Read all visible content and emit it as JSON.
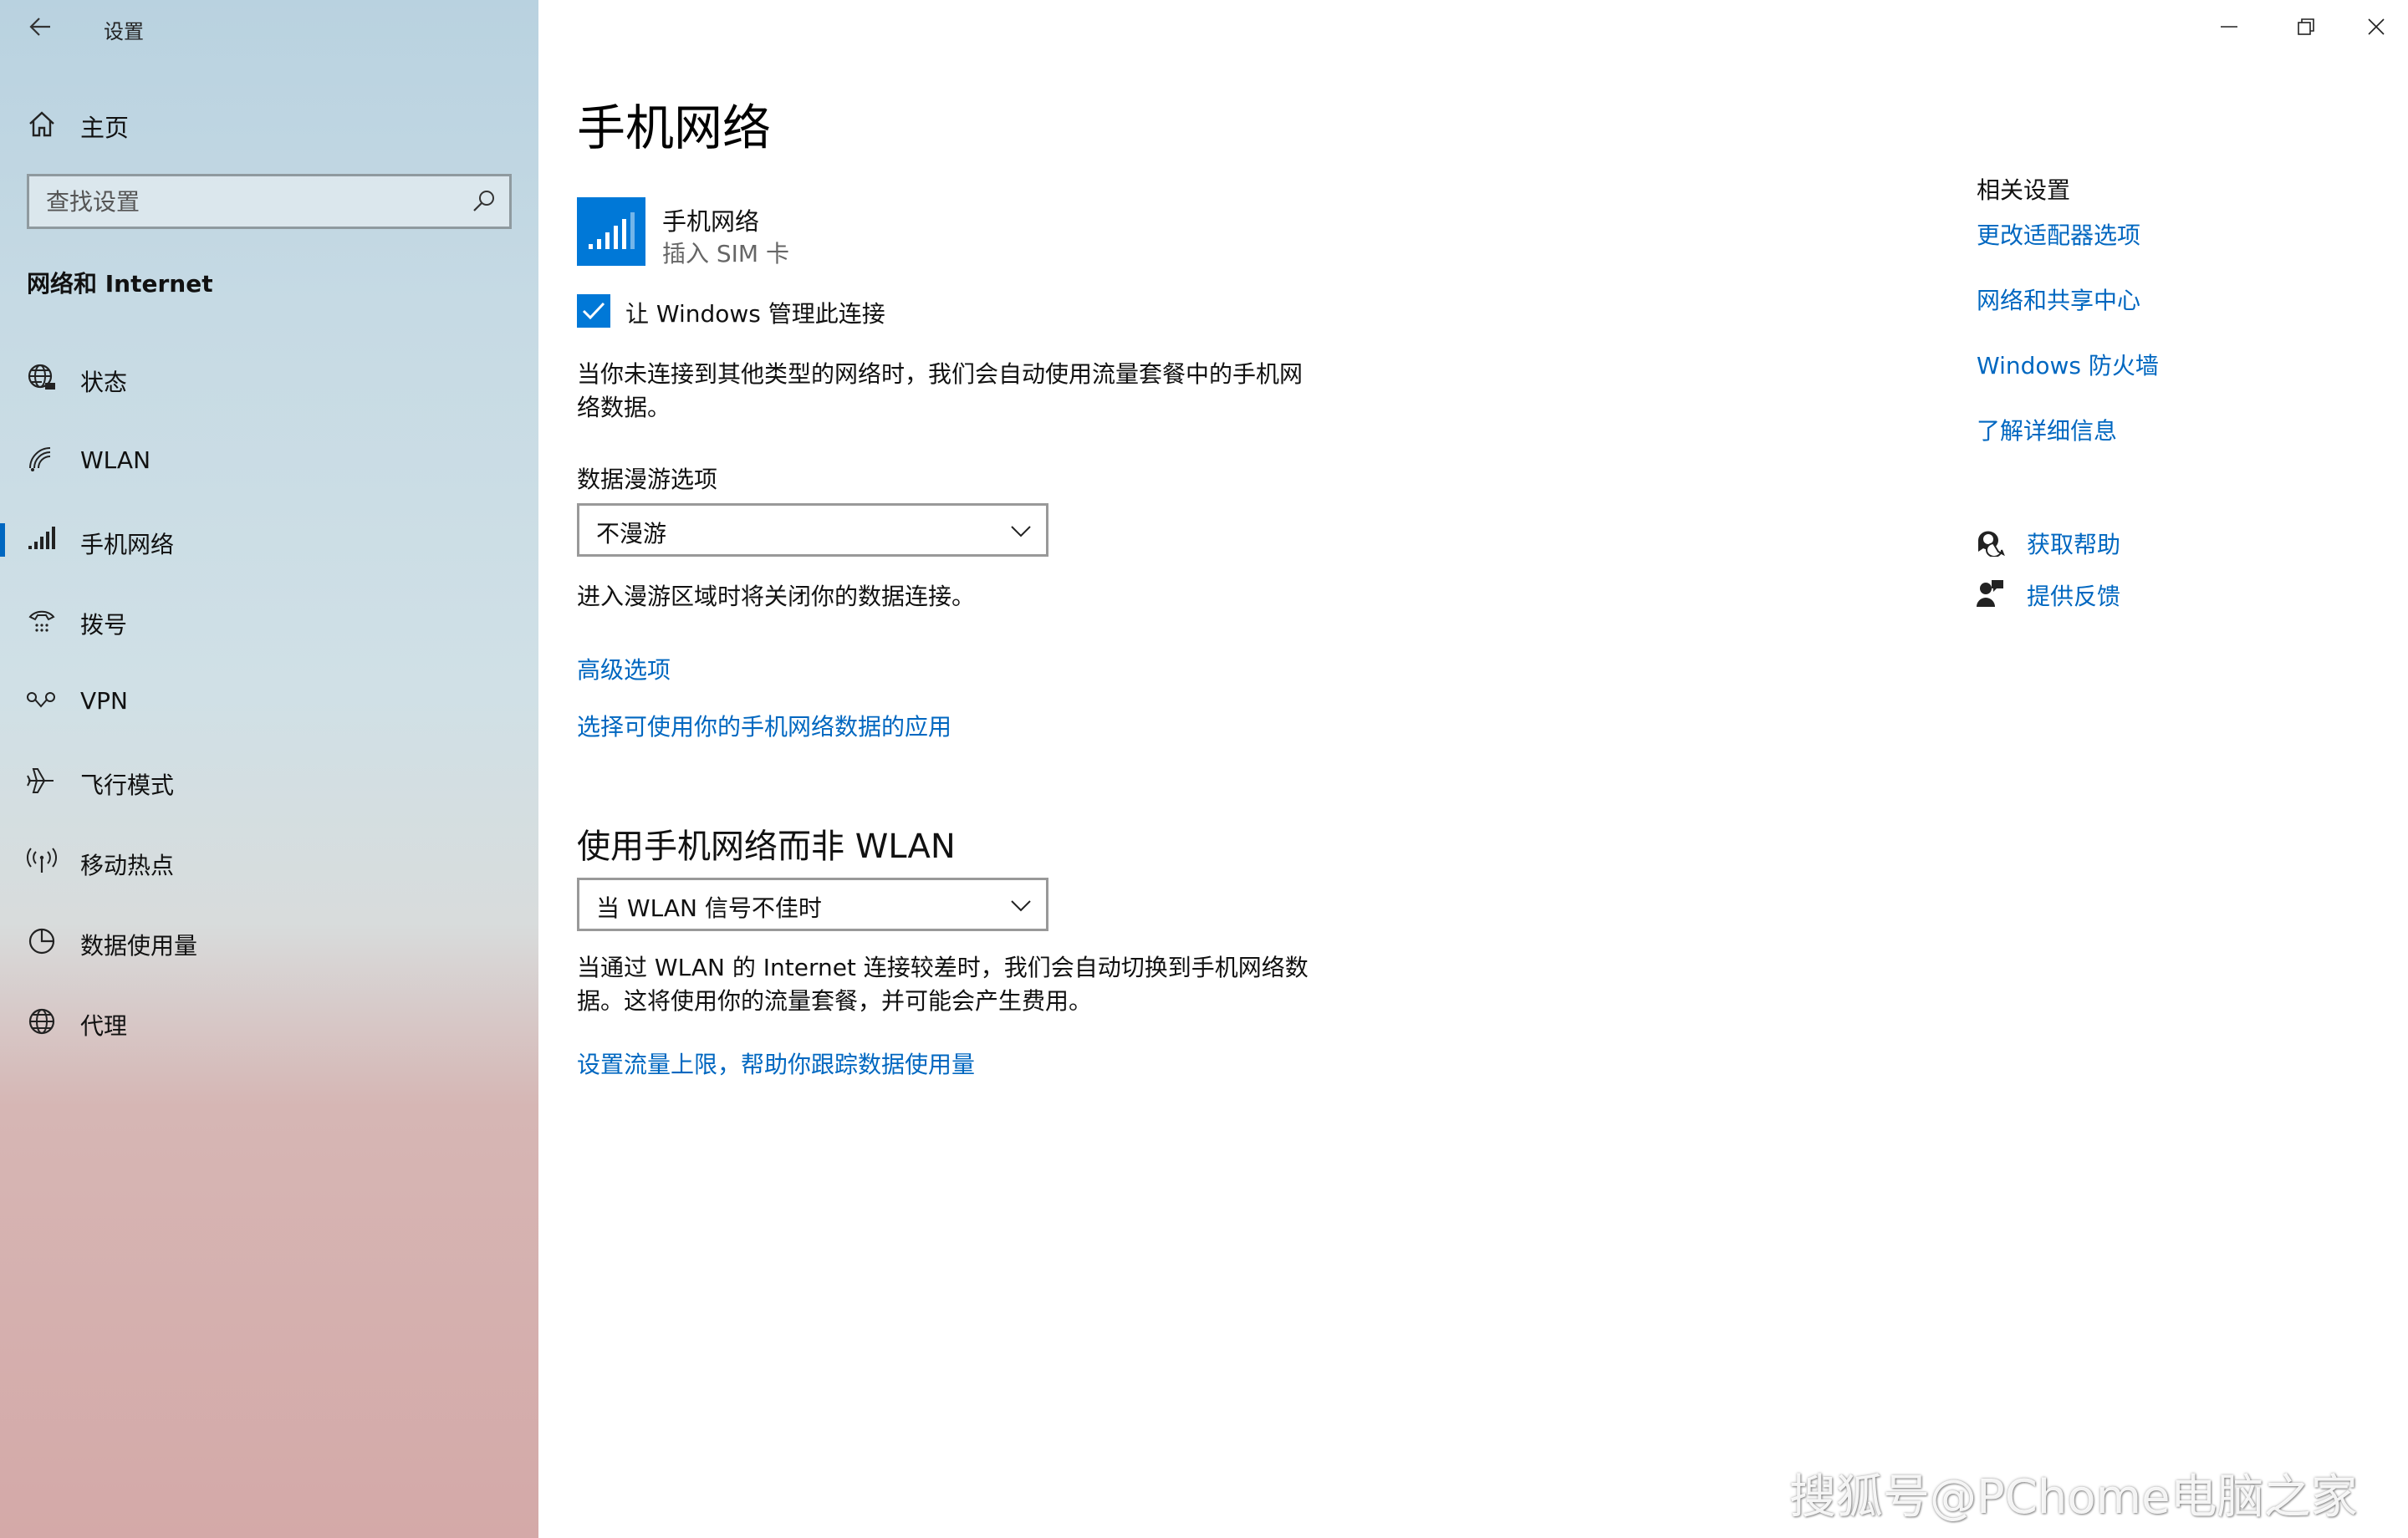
{
  "window": {
    "app_title": "设置",
    "minimize_icon": "minimize-icon",
    "restore_icon": "restore-icon",
    "close_icon": "close-icon"
  },
  "sidebar": {
    "home_label": "主页",
    "search_placeholder": "查找设置",
    "section_title": "网络和 Internet",
    "items": [
      {
        "label": "状态",
        "icon": "globe-status-icon"
      },
      {
        "label": "WLAN",
        "icon": "wifi-icon"
      },
      {
        "label": "手机网络",
        "icon": "cellular-signal-icon",
        "selected": true
      },
      {
        "label": "拨号",
        "icon": "dialup-icon"
      },
      {
        "label": "VPN",
        "icon": "vpn-icon"
      },
      {
        "label": "飞行模式",
        "icon": "airplane-icon"
      },
      {
        "label": "移动热点",
        "icon": "hotspot-icon"
      },
      {
        "label": "数据使用量",
        "icon": "data-usage-icon"
      },
      {
        "label": "代理",
        "icon": "globe-proxy-icon"
      }
    ]
  },
  "main": {
    "page_title": "手机网络",
    "sim": {
      "name": "手机网络",
      "status": "插入 SIM 卡"
    },
    "manage_checkbox": {
      "label": "让 Windows 管理此连接",
      "checked": true
    },
    "auto_desc_line1": "当你未连接到其他类型的网络时，我们会自动使用流量套餐中的手机网",
    "auto_desc_line2": "络数据。",
    "roaming_label": "数据漫游选项",
    "roaming_value": "不漫游",
    "roaming_desc": "进入漫游区域时将关闭你的数据连接。",
    "advanced_link": "高级选项",
    "apps_link": "选择可使用你的手机网络数据的应用",
    "prefer_heading": "使用手机网络而非 WLAN",
    "prefer_value": "当 WLAN 信号不佳时",
    "prefer_desc_line1": "当通过 WLAN 的 Internet 连接较差时，我们会自动切换到手机网络数",
    "prefer_desc_line2": "据。这将使用你的流量套餐，并可能会产生费用。",
    "limit_link": "设置流量上限，帮助你跟踪数据使用量"
  },
  "related": {
    "title": "相关设置",
    "links": [
      "更改适配器选项",
      "网络和共享中心",
      "Windows 防火墙",
      "了解详细信息"
    ],
    "help_label": "获取帮助",
    "feedback_label": "提供反馈"
  },
  "watermark": "搜狐号@PChome电脑之家",
  "colors": {
    "accent": "#0078d7",
    "link": "#0067c0"
  }
}
